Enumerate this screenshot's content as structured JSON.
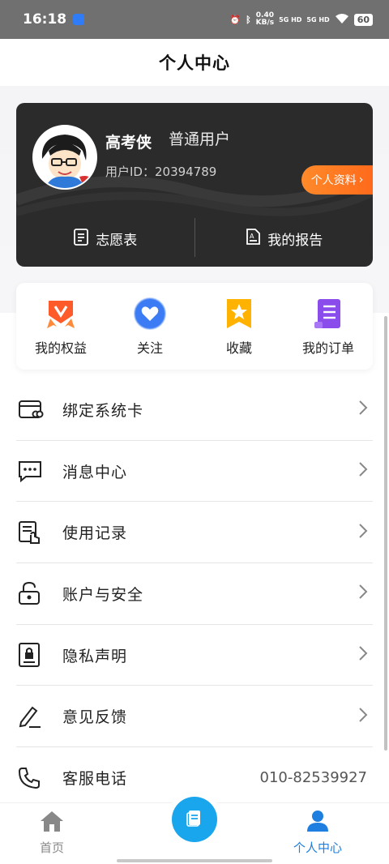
{
  "status_bar": {
    "time": "16:18",
    "speed_value": "0.40",
    "speed_unit": "KB/s",
    "net1": "5G HD",
    "net2": "5G HD",
    "battery": "60"
  },
  "header": {
    "title": "个人中心"
  },
  "profile": {
    "name": "高考侠",
    "level": "普通用户",
    "user_id_label": "用户ID：",
    "user_id": "20394789",
    "profile_button": "个人资料",
    "actions": [
      {
        "label": "志愿表",
        "icon": "clipboard-icon"
      },
      {
        "label": "我的报告",
        "icon": "report-icon"
      }
    ]
  },
  "quick_actions": [
    {
      "label": "我的权益",
      "icon": "rights-badge-icon",
      "color": "#ff5a2a"
    },
    {
      "label": "关注",
      "icon": "heart-icon",
      "color": "#3b7cf5"
    },
    {
      "label": "收藏",
      "icon": "star-bookmark-icon",
      "color": "#ffb300"
    },
    {
      "label": "我的订单",
      "icon": "order-scroll-icon",
      "color": "#8a4dec"
    }
  ],
  "menu": [
    {
      "label": "绑定系统卡",
      "icon": "card-link-icon"
    },
    {
      "label": "消息中心",
      "icon": "message-icon"
    },
    {
      "label": "使用记录",
      "icon": "record-icon"
    },
    {
      "label": "账户与安全",
      "icon": "lock-icon"
    },
    {
      "label": "隐私声明",
      "icon": "privacy-icon"
    },
    {
      "label": "意见反馈",
      "icon": "pencil-icon"
    },
    {
      "label": "客服电话",
      "icon": "phone-icon",
      "value": "010-82539927"
    }
  ],
  "bottom_nav": {
    "home": "首页",
    "me": "个人中心",
    "active_color": "#1e7fe0",
    "center_color": "#1aa6ec"
  }
}
